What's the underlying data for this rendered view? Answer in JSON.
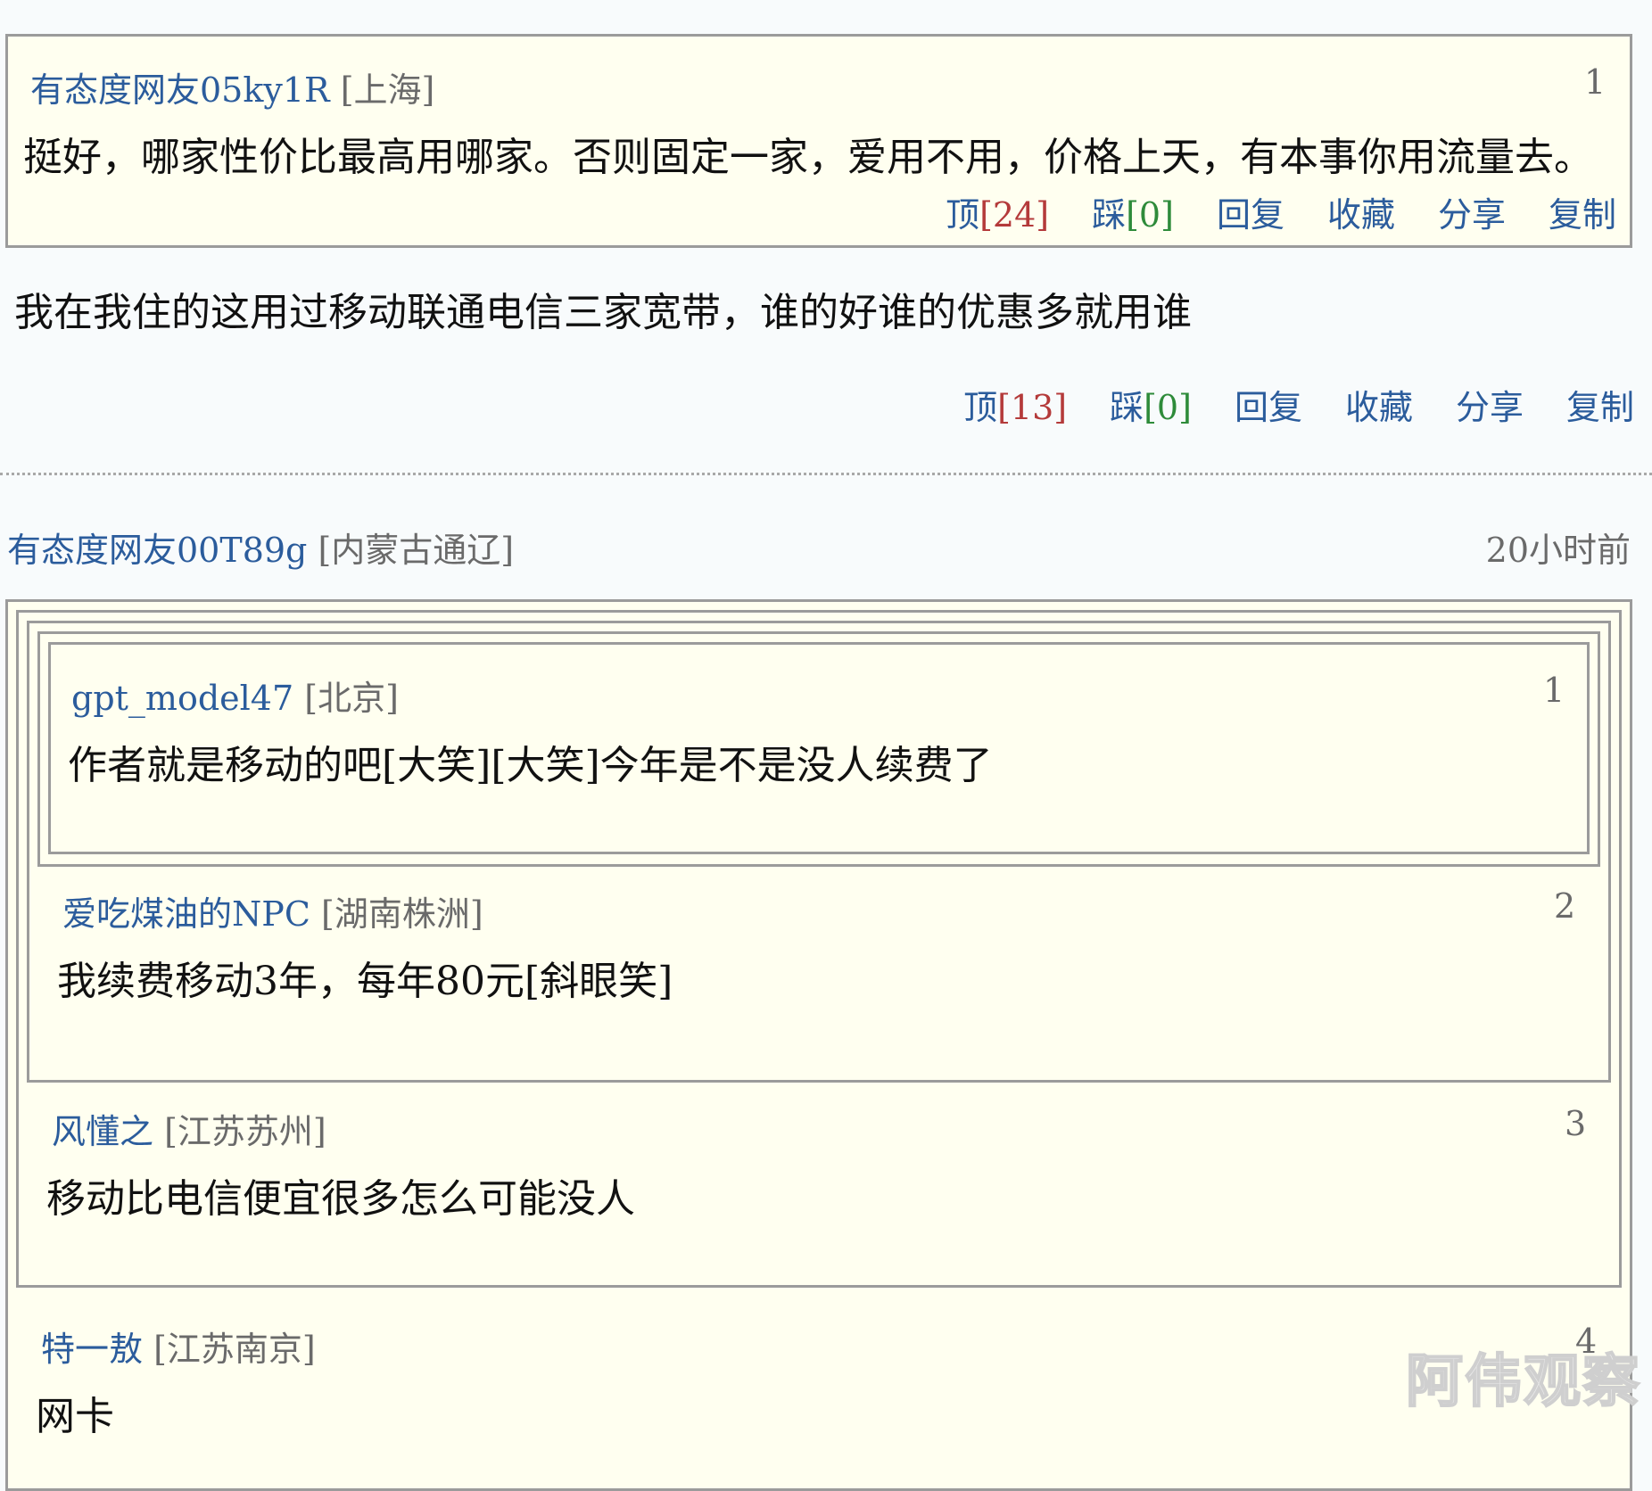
{
  "quote1": {
    "username": "有态度网友05ky1R",
    "location": "[上海]",
    "floor": "1",
    "text": "挺好，哪家性价比最高用哪家。否则固定一家，爱用不用，价格上天，有本事你用流量去。",
    "actions": {
      "up_label": "顶",
      "up_count": "[24]",
      "down_label": "踩",
      "down_count": "[0]",
      "reply": "回复",
      "fav": "收藏",
      "share": "分享",
      "copy": "复制"
    }
  },
  "reply1": {
    "text": "我在我住的这用过移动联通电信三家宽带，谁的好谁的优惠多就用谁",
    "actions": {
      "up_label": "顶",
      "up_count": "[13]",
      "down_label": "踩",
      "down_count": "[0]",
      "reply": "回复",
      "fav": "收藏",
      "share": "分享",
      "copy": "复制"
    }
  },
  "comment2": {
    "username": "有态度网友00T89g",
    "location": "[内蒙古通辽]",
    "time": "20小时前",
    "quotes": [
      {
        "username": "gpt_model47",
        "location": "[北京]",
        "floor": "1",
        "text": "作者就是移动的吧[大笑][大笑]今年是不是没人续费了"
      },
      {
        "username": "爱吃煤油的NPC",
        "location": "[湖南株洲]",
        "floor": "2",
        "text": "我续费移动3年，每年80元[斜眼笑]"
      },
      {
        "username": "风懂之",
        "location": "[江苏苏州]",
        "floor": "3",
        "text": "移动比电信便宜很多怎么可能没人"
      },
      {
        "username": "特一敖",
        "location": "[江苏南京]",
        "floor": "4",
        "text": "网卡"
      }
    ]
  },
  "watermark": "阿伟观察"
}
